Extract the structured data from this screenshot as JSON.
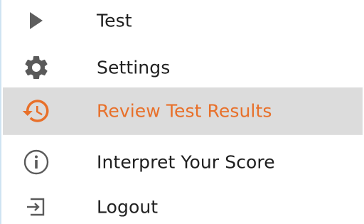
{
  "menu": {
    "items": [
      {
        "label": "Test",
        "icon": "play-icon",
        "active": false
      },
      {
        "label": "Settings",
        "icon": "gear-icon",
        "active": false
      },
      {
        "label": "Review Test Results",
        "icon": "history-icon",
        "active": true
      },
      {
        "label": "Interpret Your Score",
        "icon": "info-icon",
        "active": false
      },
      {
        "label": "Logout",
        "icon": "logout-icon",
        "active": false
      }
    ]
  },
  "colors": {
    "accent": "#e8702a",
    "active_bg": "#dcdcdc",
    "icon": "#5a5a5a",
    "text": "#202020",
    "border": "#cfe3f2"
  }
}
